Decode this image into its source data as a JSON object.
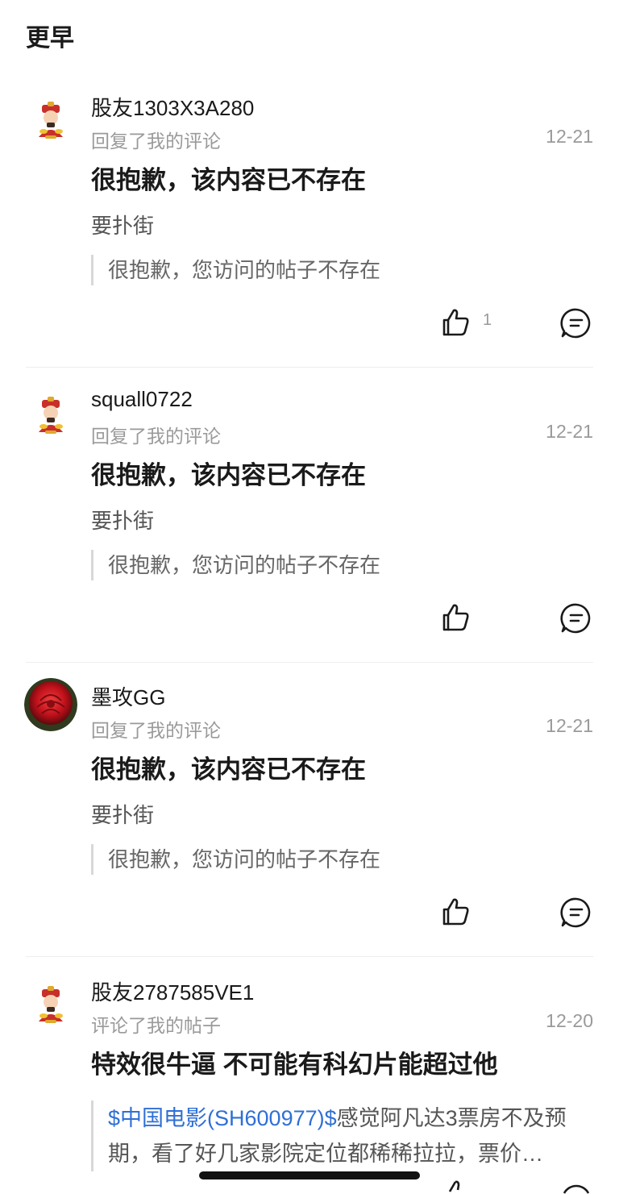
{
  "section_title": "更早",
  "notifications": [
    {
      "username": "股友1303X3A280",
      "action": "回复了我的评论",
      "date": "12-21",
      "headline": "很抱歉，该内容已不存在",
      "body": "要扑街",
      "quote": "很抱歉，您访问的帖子不存在",
      "like_count": "1",
      "avatar": "caishen-avatar"
    },
    {
      "username": "squall0722",
      "action": "回复了我的评论",
      "date": "12-21",
      "headline": "很抱歉，该内容已不存在",
      "body": "要扑街",
      "quote": "很抱歉，您访问的帖子不存在",
      "like_count": "",
      "avatar": "caishen-avatar"
    },
    {
      "username": "墨攻GG",
      "action": "回复了我的评论",
      "date": "12-21",
      "headline": "很抱歉，该内容已不存在",
      "body": "要扑街",
      "quote": "很抱歉，您访问的帖子不存在",
      "like_count": "",
      "avatar": "red-rose-photo"
    },
    {
      "username": "股友2787585VE1",
      "action": "评论了我的帖子",
      "date": "12-20",
      "headline": "特效很牛逼 不可能有科幻片能超过他",
      "quote_link": "$中国电影(SH600977)$",
      "quote_text": "感觉阿凡达3票房不及预期，看了好几家影院定位都稀稀拉拉，票价…",
      "avatar": "caishen-avatar"
    }
  ],
  "colors": {
    "link": "#2f6fd6",
    "muted": "#9a9a9a",
    "text": "#1a1a1a"
  },
  "icons": [
    "thumbs-up-icon",
    "comment-reply-icon"
  ]
}
